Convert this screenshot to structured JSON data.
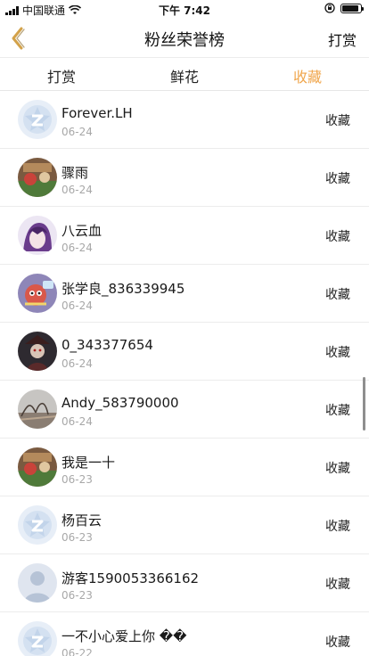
{
  "status_bar": {
    "carrier": "中国联通",
    "time": "下午 7:42",
    "battery_level": 0.9
  },
  "nav": {
    "title": "粉丝荣誉榜",
    "action_label": "打赏"
  },
  "tabs": [
    {
      "label": "打赏",
      "active": false
    },
    {
      "label": "鲜花",
      "active": false
    },
    {
      "label": "收藏",
      "active": true
    }
  ],
  "rows": [
    {
      "name": "Forever.LH",
      "date": "06-24",
      "action": "收藏",
      "avatar": "default-q-avatar"
    },
    {
      "name": "骤雨",
      "date": "06-24",
      "action": "收藏",
      "avatar": "photo-avatar"
    },
    {
      "name": "八云血",
      "date": "06-24",
      "action": "收藏",
      "avatar": "anime-avatar"
    },
    {
      "name": "张学良_836339945",
      "date": "06-24",
      "action": "收藏",
      "avatar": "cartoon-avatar"
    },
    {
      "name": "0_343377654",
      "date": "06-24",
      "action": "收藏",
      "avatar": "dark-portrait-avatar"
    },
    {
      "name": "Andy_583790000",
      "date": "06-24",
      "action": "收藏",
      "avatar": "landscape-avatar"
    },
    {
      "name": "我是一十",
      "date": "06-23",
      "action": "收藏",
      "avatar": "photo-avatar"
    },
    {
      "name": "杨百云",
      "date": "06-23",
      "action": "收藏",
      "avatar": "default-q-avatar"
    },
    {
      "name": "游客1590053366162",
      "date": "06-23",
      "action": "收藏",
      "avatar": "guest-avatar"
    },
    {
      "name": "一不小心爱上你 ��",
      "date": "06-22",
      "action": "收藏",
      "avatar": "default-q-avatar"
    }
  ],
  "colors": {
    "accent": "#f0a64c",
    "text": "#222222",
    "muted": "#a8a8a8",
    "divider": "#ececec"
  }
}
